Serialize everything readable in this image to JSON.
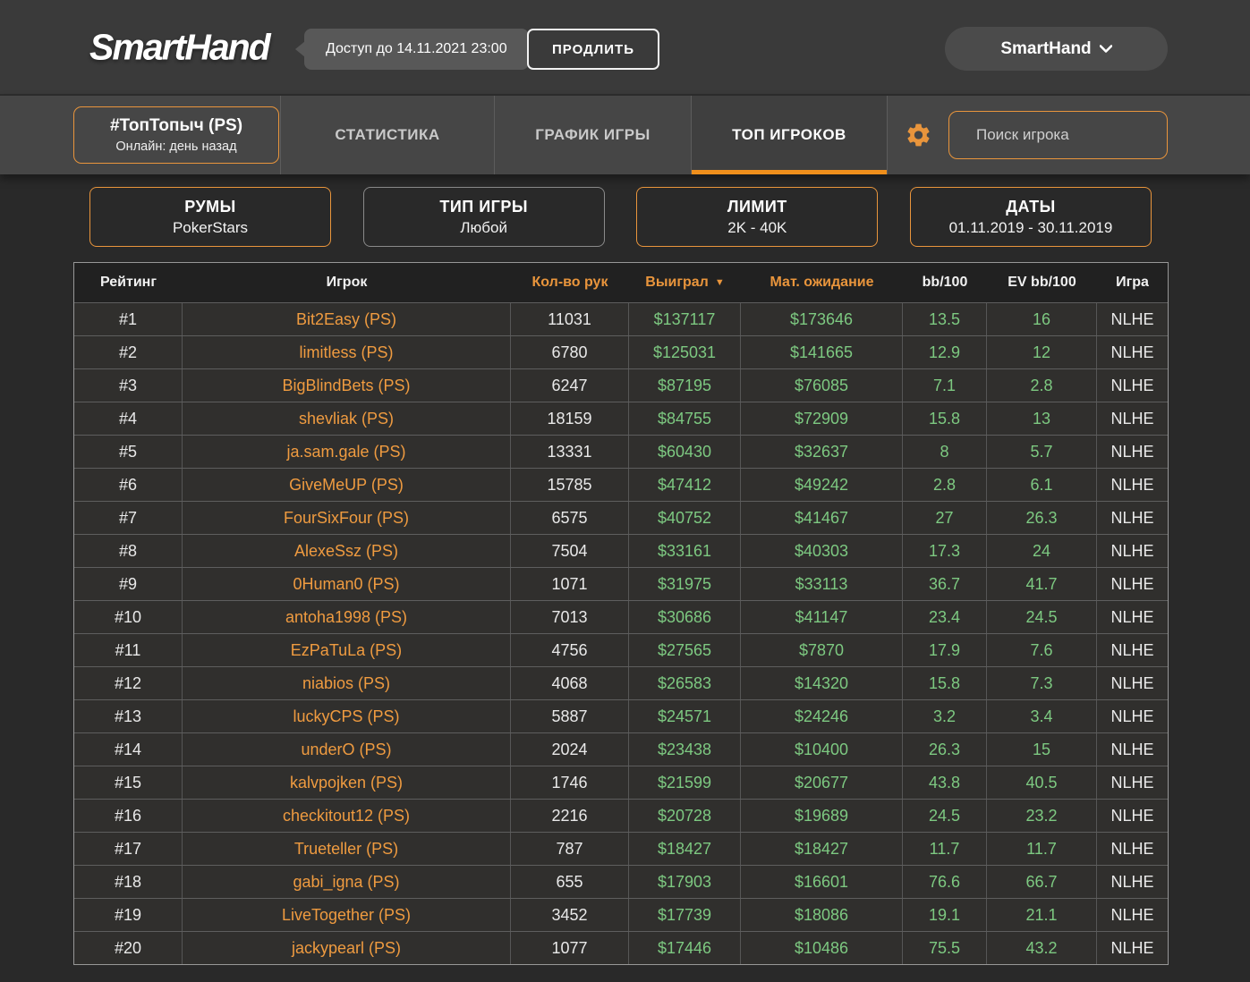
{
  "header": {
    "logo": "SmartHand",
    "access_badge": "Доступ до 14.11.2021 23:00",
    "extend_button": "ПРОДЛИТЬ",
    "account_menu": "SmartHand"
  },
  "nav": {
    "profile": {
      "name": "#ТопТопыч (PS)",
      "status": "Онлайн: день назад"
    },
    "tabs": [
      {
        "label": "СТАТИСТИКА",
        "active": false
      },
      {
        "label": "ГРАФИК ИГРЫ",
        "active": false
      },
      {
        "label": "ТОП ИГРОКОВ",
        "active": true
      }
    ],
    "gear_icon": "settings-gear",
    "search_placeholder": "Поиск игрока"
  },
  "filters": [
    {
      "title": "РУМЫ",
      "value": "PokerStars",
      "highlighted": true
    },
    {
      "title": "ТИП ИГРЫ",
      "value": "Любой",
      "highlighted": false
    },
    {
      "title": "ЛИМИТ",
      "value": "2K - 40K",
      "highlighted": true
    },
    {
      "title": "ДАТЫ",
      "value": "01.11.2019 - 30.11.2019",
      "highlighted": true
    }
  ],
  "table": {
    "sort_arrow": "▼",
    "columns": [
      {
        "key": "rank",
        "label": "Рейтинг",
        "accent": false,
        "sortable": false
      },
      {
        "key": "player",
        "label": "Игрок",
        "accent": false,
        "sortable": false
      },
      {
        "key": "hands",
        "label": "Кол-во рук",
        "accent": true,
        "sortable": true
      },
      {
        "key": "won",
        "label": "Выиграл",
        "accent": true,
        "sortable": true,
        "sort": "desc"
      },
      {
        "key": "expected",
        "label": "Мат. ожидание",
        "accent": true,
        "sortable": true
      },
      {
        "key": "bb100",
        "label": "bb/100",
        "accent": false,
        "sortable": false
      },
      {
        "key": "ev_bb100",
        "label": "EV bb/100",
        "accent": false,
        "sortable": false
      },
      {
        "key": "game",
        "label": "Игра",
        "accent": false,
        "sortable": false
      }
    ],
    "rows": [
      {
        "rank": "#1",
        "player": "Bit2Easy (PS)",
        "hands": "11031",
        "won": "$137117",
        "expected": "$173646",
        "bb100": "13.5",
        "ev_bb100": "16",
        "game": "NLHE"
      },
      {
        "rank": "#2",
        "player": "limitless (PS)",
        "hands": "6780",
        "won": "$125031",
        "expected": "$141665",
        "bb100": "12.9",
        "ev_bb100": "12",
        "game": "NLHE"
      },
      {
        "rank": "#3",
        "player": "BigBlindBets (PS)",
        "hands": "6247",
        "won": "$87195",
        "expected": "$76085",
        "bb100": "7.1",
        "ev_bb100": "2.8",
        "game": "NLHE"
      },
      {
        "rank": "#4",
        "player": "shevliak (PS)",
        "hands": "18159",
        "won": "$84755",
        "expected": "$72909",
        "bb100": "15.8",
        "ev_bb100": "13",
        "game": "NLHE"
      },
      {
        "rank": "#5",
        "player": "ja.sam.gale (PS)",
        "hands": "13331",
        "won": "$60430",
        "expected": "$32637",
        "bb100": "8",
        "ev_bb100": "5.7",
        "game": "NLHE"
      },
      {
        "rank": "#6",
        "player": "GiveMeUP (PS)",
        "hands": "15785",
        "won": "$47412",
        "expected": "$49242",
        "bb100": "2.8",
        "ev_bb100": "6.1",
        "game": "NLHE"
      },
      {
        "rank": "#7",
        "player": "FourSixFour (PS)",
        "hands": "6575",
        "won": "$40752",
        "expected": "$41467",
        "bb100": "27",
        "ev_bb100": "26.3",
        "game": "NLHE"
      },
      {
        "rank": "#8",
        "player": "AlexeSsz (PS)",
        "hands": "7504",
        "won": "$33161",
        "expected": "$40303",
        "bb100": "17.3",
        "ev_bb100": "24",
        "game": "NLHE"
      },
      {
        "rank": "#9",
        "player": "0Human0 (PS)",
        "hands": "1071",
        "won": "$31975",
        "expected": "$33113",
        "bb100": "36.7",
        "ev_bb100": "41.7",
        "game": "NLHE"
      },
      {
        "rank": "#10",
        "player": "antoha1998 (PS)",
        "hands": "7013",
        "won": "$30686",
        "expected": "$41147",
        "bb100": "23.4",
        "ev_bb100": "24.5",
        "game": "NLHE"
      },
      {
        "rank": "#11",
        "player": "EzPaTuLa (PS)",
        "hands": "4756",
        "won": "$27565",
        "expected": "$7870",
        "bb100": "17.9",
        "ev_bb100": "7.6",
        "game": "NLHE"
      },
      {
        "rank": "#12",
        "player": "niabios (PS)",
        "hands": "4068",
        "won": "$26583",
        "expected": "$14320",
        "bb100": "15.8",
        "ev_bb100": "7.3",
        "game": "NLHE"
      },
      {
        "rank": "#13",
        "player": "luckyCPS (PS)",
        "hands": "5887",
        "won": "$24571",
        "expected": "$24246",
        "bb100": "3.2",
        "ev_bb100": "3.4",
        "game": "NLHE"
      },
      {
        "rank": "#14",
        "player": "underO (PS)",
        "hands": "2024",
        "won": "$23438",
        "expected": "$10400",
        "bb100": "26.3",
        "ev_bb100": "15",
        "game": "NLHE"
      },
      {
        "rank": "#15",
        "player": "kalvpojken (PS)",
        "hands": "1746",
        "won": "$21599",
        "expected": "$20677",
        "bb100": "43.8",
        "ev_bb100": "40.5",
        "game": "NLHE"
      },
      {
        "rank": "#16",
        "player": "checkitout12 (PS)",
        "hands": "2216",
        "won": "$20728",
        "expected": "$19689",
        "bb100": "24.5",
        "ev_bb100": "23.2",
        "game": "NLHE"
      },
      {
        "rank": "#17",
        "player": "Trueteller (PS)",
        "hands": "787",
        "won": "$18427",
        "expected": "$18427",
        "bb100": "11.7",
        "ev_bb100": "11.7",
        "game": "NLHE"
      },
      {
        "rank": "#18",
        "player": "gabi_igna (PS)",
        "hands": "655",
        "won": "$17903",
        "expected": "$16601",
        "bb100": "76.6",
        "ev_bb100": "66.7",
        "game": "NLHE"
      },
      {
        "rank": "#19",
        "player": "LiveTogether (PS)",
        "hands": "3452",
        "won": "$17739",
        "expected": "$18086",
        "bb100": "19.1",
        "ev_bb100": "21.1",
        "game": "NLHE"
      },
      {
        "rank": "#20",
        "player": "jackypearl (PS)",
        "hands": "1077",
        "won": "$17446",
        "expected": "$10486",
        "bb100": "75.5",
        "ev_bb100": "43.2",
        "game": "NLHE"
      }
    ]
  },
  "colors": {
    "accent": "#e9953c",
    "positive": "#7dc981",
    "player": "#ef9b40"
  }
}
